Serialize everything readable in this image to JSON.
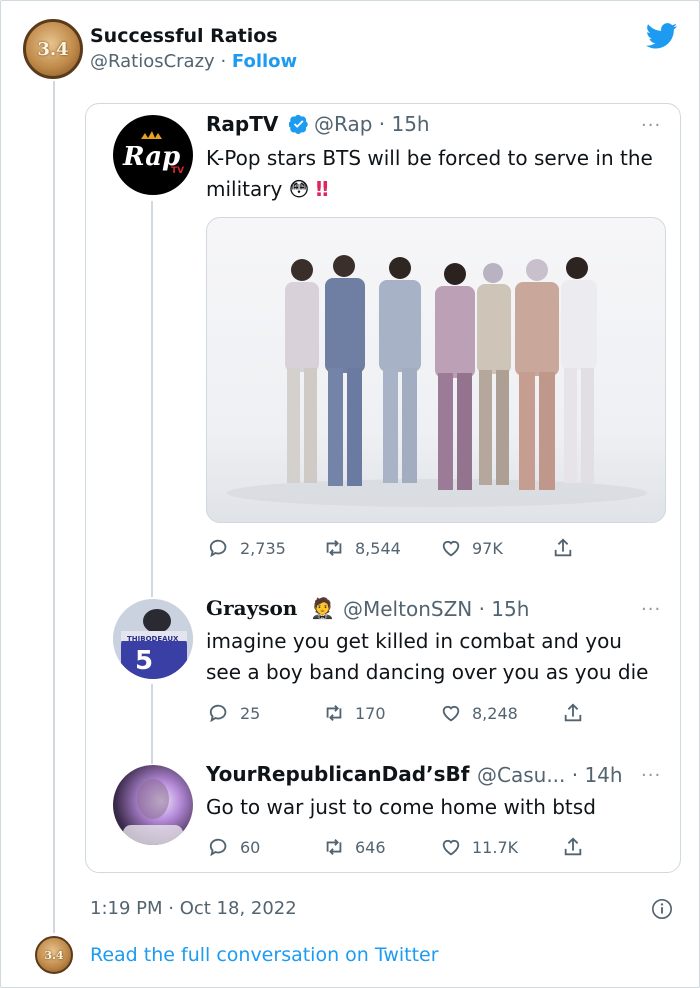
{
  "header": {
    "author_name": "Successful Ratios",
    "handle": "@RatiosCrazy",
    "separator": "·",
    "follow_label": "Follow",
    "avatar_text": "3.4"
  },
  "quoted": {
    "name": "RapTV",
    "handle_time": "@Rap · 15h",
    "text": "K-Pop stars BTS will be forced to serve in the military",
    "emoji": "😳",
    "exclaim": "‼",
    "avatar_text": "Rap",
    "avatar_sub": "TV",
    "stats": {
      "replies": "2,735",
      "retweets": "8,544",
      "likes": "97K"
    }
  },
  "replies": [
    {
      "name": "Grayson",
      "emoji": "🤵",
      "handle_time": "@MeltonSZN · 15h",
      "text_line1": "imagine you get killed in combat and you",
      "text_line2": "see a boy band dancing over you as you die",
      "jersey_name": "THIBODEAUX",
      "jersey_number": "5",
      "stats": {
        "replies": "25",
        "retweets": "170",
        "likes": "8,248"
      }
    },
    {
      "name": "YourRepublicanDad’sBf",
      "handle_time": "@Casu... · 14h",
      "text": "Go to war just to come home with btsd",
      "stats": {
        "replies": "60",
        "retweets": "646",
        "likes": "11.7K"
      }
    }
  ],
  "footer": {
    "timestamp": "1:19 PM · Oct 18, 2022",
    "read_more": "Read the full conversation on Twitter"
  },
  "colors": {
    "link": "#1d9bf0",
    "muted": "#536471",
    "border": "#cfd9de",
    "verified": "#1d9bf0",
    "exclaim": "#e0245e"
  },
  "icons": [
    "twitter-bird-icon",
    "verified-badge-icon",
    "reply-icon",
    "retweet-icon",
    "like-icon",
    "share-icon",
    "more-icon",
    "info-icon"
  ]
}
